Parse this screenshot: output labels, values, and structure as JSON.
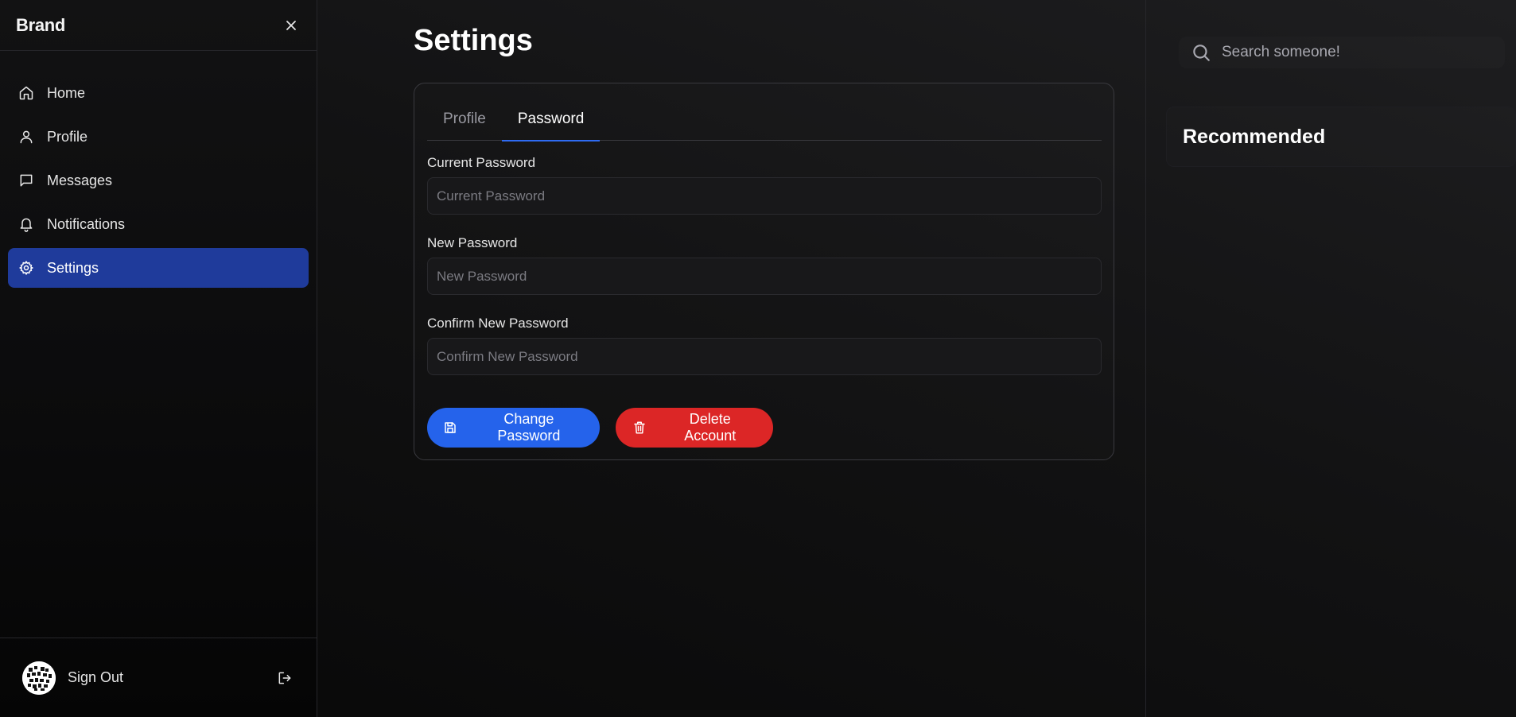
{
  "sidebar": {
    "brand": "Brand",
    "items": [
      {
        "label": "Home",
        "icon": "home-icon"
      },
      {
        "label": "Profile",
        "icon": "user-icon"
      },
      {
        "label": "Messages",
        "icon": "message-icon"
      },
      {
        "label": "Notifications",
        "icon": "bell-icon"
      },
      {
        "label": "Settings",
        "icon": "gear-icon",
        "active": true
      }
    ],
    "footer": {
      "signout_label": "Sign Out"
    }
  },
  "main": {
    "title": "Settings",
    "tabs": [
      {
        "label": "Profile",
        "active": false
      },
      {
        "label": "Password",
        "active": true
      }
    ],
    "form": {
      "current_password": {
        "label": "Current Password",
        "placeholder": "Current Password",
        "value": ""
      },
      "new_password": {
        "label": "New Password",
        "placeholder": "New Password",
        "value": ""
      },
      "confirm_password": {
        "label": "Confirm New Password",
        "placeholder": "Confirm New Password",
        "value": ""
      }
    },
    "buttons": {
      "change_password": "Change Password",
      "delete_account": "Delete Account"
    }
  },
  "right": {
    "search": {
      "placeholder": "Search someone!",
      "value": ""
    },
    "recommended_title": "Recommended"
  },
  "colors": {
    "accent_blue": "#2563eb",
    "active_nav": "#1f3b9b",
    "danger_red": "#dc2626",
    "tab_underline": "#2f6bf2"
  }
}
